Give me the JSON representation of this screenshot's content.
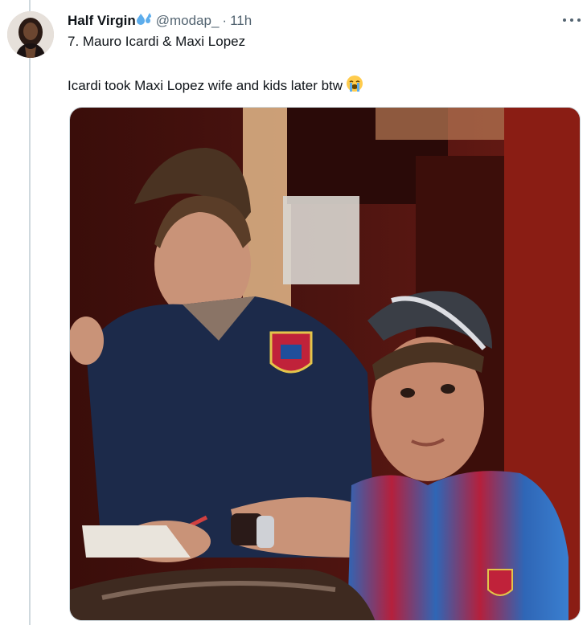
{
  "author": {
    "display_name": "Half Virgin",
    "name_emoji_icon": "sweat-droplets-icon",
    "handle": "@modap_",
    "separator": "·",
    "timestamp": "11h",
    "avatar_icon": "avatar-photo"
  },
  "reply_context": "7. Mauro Icardi & Maxi Lopez",
  "tweet": {
    "text": "Icardi took Maxi Lopez wife and kids later btw",
    "emoji_icon": "loudly-crying-face-icon"
  },
  "more_icon": "more-options-icon",
  "media": {
    "type": "photo",
    "colors": {
      "accent_blue": "#1d9bf0",
      "jersey_navy": "#1c2a4a",
      "jersey_red": "#c0223a",
      "background_wood": "#5a1712"
    }
  }
}
